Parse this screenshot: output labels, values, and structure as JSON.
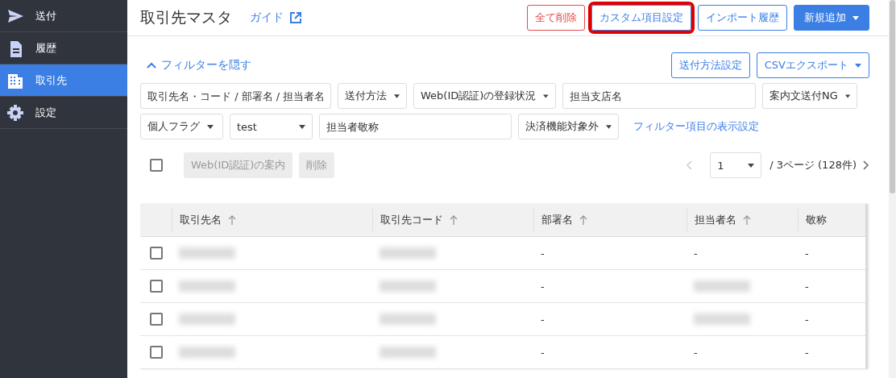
{
  "sidebar": {
    "items": [
      {
        "label": "送付",
        "selected": false
      },
      {
        "label": "履歴",
        "selected": false
      },
      {
        "label": "取引先",
        "selected": true
      },
      {
        "label": "設定",
        "selected": false
      }
    ]
  },
  "header": {
    "title": "取引先マスタ",
    "guide_link": "ガイド",
    "buttons": [
      {
        "label": "全て削除",
        "kind": "danger",
        "highlighted": false
      },
      {
        "label": "カスタム項目設定",
        "kind": "outline",
        "highlighted": true
      },
      {
        "label": "インポート履歴",
        "kind": "outline",
        "highlighted": false
      },
      {
        "label": "新規追加",
        "kind": "primary",
        "highlighted": false,
        "caret": true
      }
    ]
  },
  "filter_toggle": "フィルターを隠す",
  "filter_actions": [
    {
      "label": "送付方法設定",
      "caret": false
    },
    {
      "label": "CSVエクスポート",
      "caret": true
    }
  ],
  "filter_rows": [
    [
      {
        "kind": "field",
        "placeholder": "取引先名・コード / 部署名 / 担当者名"
      },
      {
        "kind": "dropdown",
        "label": "送付方法"
      },
      {
        "kind": "dropdown",
        "label": "Web(ID認証)の登録状況"
      },
      {
        "kind": "field",
        "placeholder": "担当支店名"
      },
      {
        "kind": "dropdown",
        "label": "案内文送付NG"
      }
    ],
    [
      {
        "kind": "dropdown",
        "label": "個人フラグ"
      },
      {
        "kind": "select",
        "value": "test"
      },
      {
        "kind": "field",
        "placeholder": "担当者敬称"
      },
      {
        "kind": "dropdown",
        "label": "決済機能対象外"
      },
      {
        "kind": "link",
        "label": "フィルター項目の表示設定"
      }
    ]
  ],
  "bulk": {
    "checked": false,
    "buttons": [
      {
        "label": "Web(ID認証)の案内",
        "disabled": true
      },
      {
        "label": "削除",
        "disabled": true
      }
    ]
  },
  "pagination": {
    "page": "1",
    "total": "/  3ページ (128件)"
  },
  "table": {
    "columns": [
      {
        "label": "取引先名",
        "sortable": true
      },
      {
        "label": "取引先コード",
        "sortable": true
      },
      {
        "label": "部署名",
        "sortable": true
      },
      {
        "label": "担当者名",
        "sortable": true
      },
      {
        "label": "敬称",
        "sortable": false
      }
    ],
    "rows": [
      {
        "checked": false,
        "cells": [
          {
            "kind": "redacted"
          },
          {
            "kind": "redacted"
          },
          {
            "kind": "text",
            "text": "-"
          },
          {
            "kind": "text",
            "text": "-"
          },
          {
            "kind": "text",
            "text": "-"
          }
        ]
      },
      {
        "checked": false,
        "cells": [
          {
            "kind": "redacted"
          },
          {
            "kind": "redacted"
          },
          {
            "kind": "text",
            "text": "-"
          },
          {
            "kind": "redacted"
          },
          {
            "kind": "text",
            "text": "-"
          }
        ]
      },
      {
        "checked": false,
        "cells": [
          {
            "kind": "redacted"
          },
          {
            "kind": "redacted"
          },
          {
            "kind": "text",
            "text": "-"
          },
          {
            "kind": "redacted"
          },
          {
            "kind": "text",
            "text": "-"
          }
        ]
      },
      {
        "checked": false,
        "cells": [
          {
            "kind": "redacted"
          },
          {
            "kind": "redacted"
          },
          {
            "kind": "text",
            "text": "-"
          },
          {
            "kind": "text",
            "text": "-"
          },
          {
            "kind": "text",
            "text": "-"
          }
        ]
      }
    ]
  }
}
